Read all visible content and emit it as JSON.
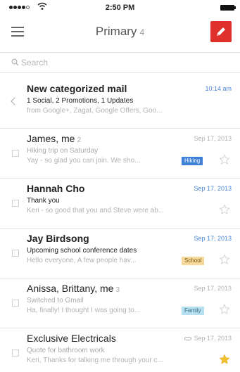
{
  "status_bar": {
    "time": "2:50 PM"
  },
  "header": {
    "title": "Primary",
    "count": "4"
  },
  "search": {
    "placeholder": "Search"
  },
  "colors": {
    "compose": "#e0302c",
    "unread_date": "#4a86d6",
    "hiking_label": "#3f7fd6",
    "school_label": "#f6d89b",
    "family_label": "#b6e0f0",
    "star_active": "#f2c12e"
  },
  "icons": [
    "menu-icon",
    "compose-icon",
    "search-icon",
    "chevron-left-icon",
    "star-icon",
    "attachment-icon"
  ],
  "mails": [
    {
      "sender": "New categorized mail",
      "thread_count": "",
      "date": "10:14 am",
      "subject": "1 Social, 2 Promotions, 1 Updates",
      "snippet": "from Google+, Zagat, Google Offers, Goo...",
      "label": "",
      "unread": true,
      "starred": false
    },
    {
      "sender": "James, me",
      "thread_count": "2",
      "date": "Sep 17, 2013",
      "subject": "Hiking trip on Saturday",
      "snippet": "Yay - so glad you can join. We sho...",
      "label": "Hiking",
      "unread": false,
      "starred": false
    },
    {
      "sender": "Hannah Cho",
      "thread_count": "",
      "date": "Sep 17, 2013",
      "subject": "Thank you",
      "snippet": "Keri - so good that you and Steve were ab...",
      "label": "",
      "unread": true,
      "starred": false
    },
    {
      "sender": "Jay Birdsong",
      "thread_count": "",
      "date": "Sep 17, 2013",
      "subject": "Upcoming school conference dates",
      "snippet": "Hello everyone, A few people hav...",
      "label": "School",
      "unread": true,
      "starred": false
    },
    {
      "sender": "Anissa, Brittany, me",
      "thread_count": "3",
      "date": "Sep 17, 2013",
      "subject": "Switched to Gmail",
      "snippet": "Ha, finally! I thought I was going to...",
      "label": "Family",
      "unread": false,
      "starred": false
    },
    {
      "sender": "Exclusive Electricals",
      "thread_count": "",
      "date": "Sep 17, 2013",
      "subject": "Quote for bathroom work",
      "snippet": "Keri, Thanks for talking me through your c...",
      "label": "",
      "unread": false,
      "starred": true
    }
  ]
}
